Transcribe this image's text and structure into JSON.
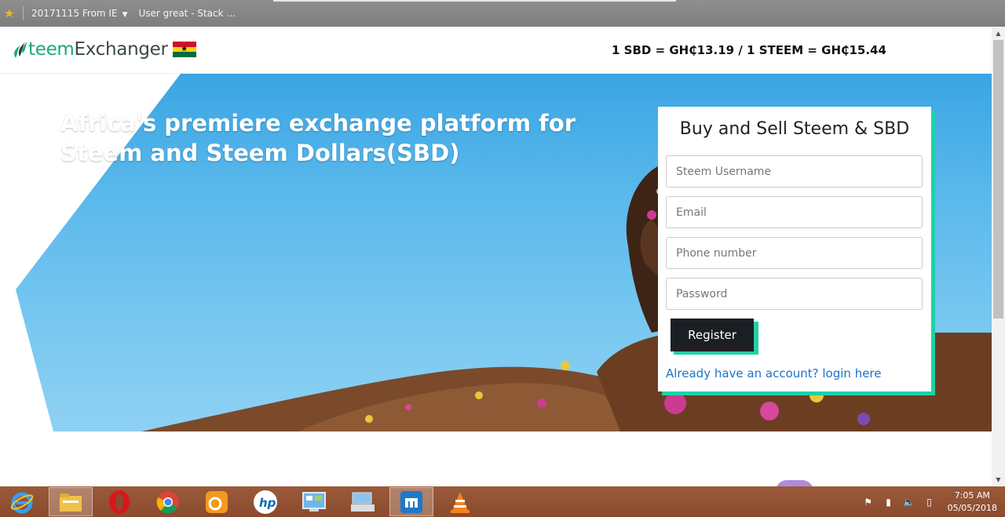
{
  "browser": {
    "bookmarks": [
      {
        "label": "20171115 From IE",
        "has_dropdown": true
      },
      {
        "label": "User great - Stack ...",
        "has_dropdown": false
      }
    ]
  },
  "header": {
    "logo_s": "S",
    "logo_rest_teem": "teem",
    "logo_rest_exchanger": "Exchanger",
    "rates": "1 SBD = GH₵13.19 / 1 STEEM = GH₵15.44"
  },
  "hero": {
    "title": "Africa's premiere exchange platform for Steem and Steem Dollars(SBD)"
  },
  "register_form": {
    "title": "Buy and Sell Steem & SBD",
    "username_placeholder": "Steem Username",
    "email_placeholder": "Email",
    "phone_placeholder": "Phone number",
    "password_placeholder": "Password",
    "submit_label": "Register",
    "login_link": "Already have an account? login here"
  },
  "taskbar": {
    "apps": [
      "internet-explorer",
      "file-explorer",
      "opera",
      "chrome",
      "uc-browser",
      "hp",
      "control-panel",
      "on-screen-keyboard",
      "maxthon",
      "vlc"
    ],
    "time": "7:05 AM",
    "date": "05/05/2018"
  },
  "colors": {
    "accent_green": "#1fd1a8",
    "button_dark": "#1b1f24",
    "link_blue": "#1a73c8",
    "sky_blue": "#3aa5e3"
  }
}
